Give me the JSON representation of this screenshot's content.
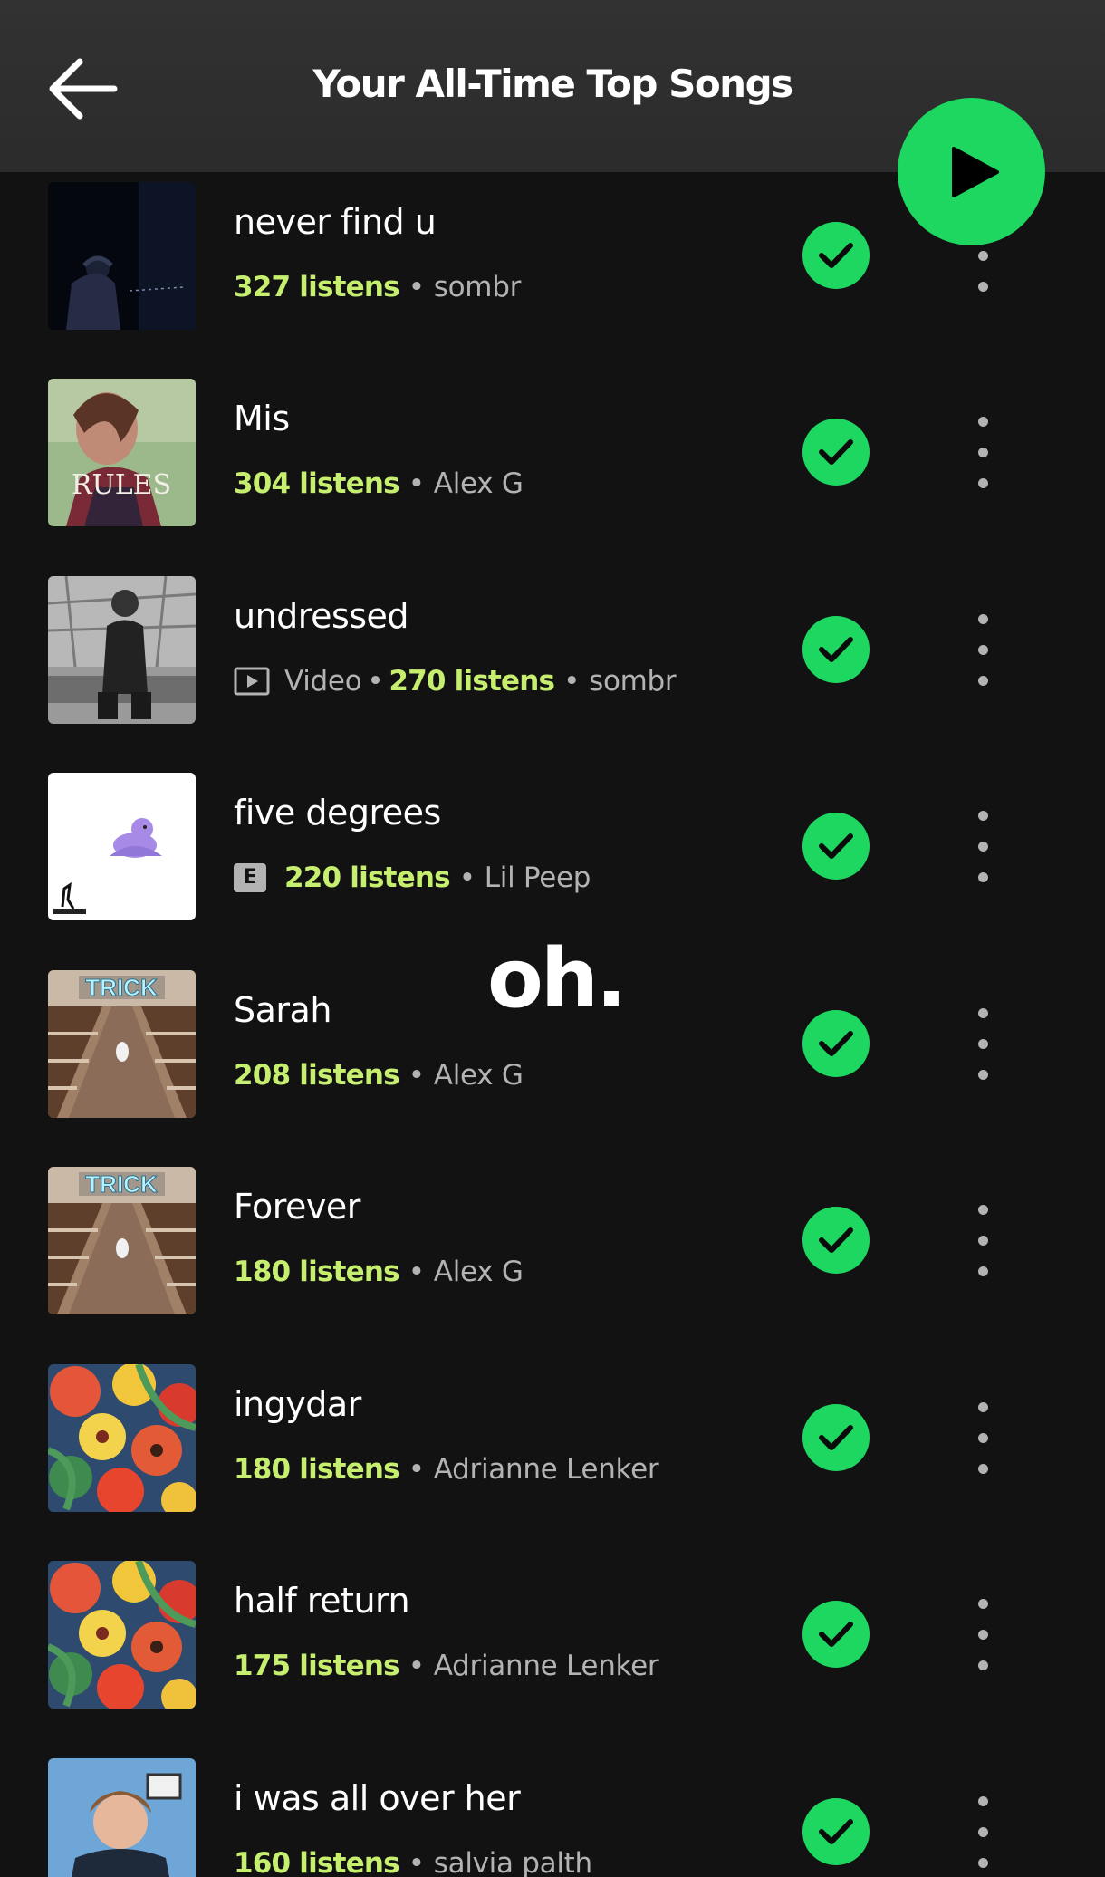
{
  "header": {
    "title": "Your All-Time Top Songs",
    "back_icon": "arrow-left-icon",
    "play_icon": "play-icon"
  },
  "colors": {
    "accent": "#1ed760",
    "listens": "#c7ef6f",
    "background": "#121212",
    "secondary_text": "#b3b3b3"
  },
  "overlay": {
    "text": "oh."
  },
  "songs": [
    {
      "title": "never find u",
      "listens": "327 listens",
      "artist": "sombr",
      "badge": "",
      "type": "",
      "saved_icon": "check-circle-icon"
    },
    {
      "title": "Mis",
      "listens": "304 listens",
      "artist": "Alex G",
      "badge": "",
      "type": "",
      "saved_icon": "check-circle-icon",
      "cover_text": "RULES"
    },
    {
      "title": "undressed",
      "listens": "270 listens",
      "artist": "sombr",
      "badge": "",
      "type": "Video",
      "saved_icon": "check-circle-icon"
    },
    {
      "title": "five degrees",
      "listens": "220 listens",
      "artist": "Lil Peep",
      "badge": "E",
      "type": "",
      "saved_icon": "check-circle-icon"
    },
    {
      "title": "Sarah",
      "listens": "208 listens",
      "artist": "Alex G",
      "badge": "",
      "type": "",
      "saved_icon": "check-circle-icon",
      "cover_text": "TRICK"
    },
    {
      "title": "Forever",
      "listens": "180 listens",
      "artist": "Alex G",
      "badge": "",
      "type": "",
      "saved_icon": "check-circle-icon",
      "cover_text": "TRICK"
    },
    {
      "title": "ingydar",
      "listens": "180 listens",
      "artist": "Adrianne Lenker",
      "badge": "",
      "type": "",
      "saved_icon": "check-circle-icon"
    },
    {
      "title": "half return",
      "listens": "175 listens",
      "artist": "Adrianne Lenker",
      "badge": "",
      "type": "",
      "saved_icon": "check-circle-icon"
    },
    {
      "title": "i was all over her",
      "listens": "160 listens",
      "artist": "salvia palth",
      "badge": "",
      "type": "",
      "saved_icon": "check-circle-icon"
    }
  ]
}
